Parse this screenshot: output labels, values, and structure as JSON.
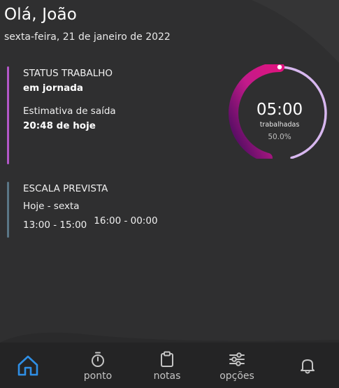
{
  "header": {
    "greeting": "Olá, João",
    "date": "sexta-feira, 21 de janeiro de 2022"
  },
  "status_card": {
    "title": "STATUS TRABALHO",
    "status": "em jornada",
    "exit_label": "Estimativa de saída",
    "exit_value": "20:48 de hoje",
    "accent": "#b357c8"
  },
  "schedule_card": {
    "title": "ESCALA PREVISTA",
    "days": "Hoje - sexta",
    "shift_1": "13:00 - 15:00",
    "shift_2": "16:00 - 00:00",
    "accent": "#5a7686"
  },
  "gauge": {
    "time": "05:00",
    "caption": "trabalhadas",
    "percent_label": "50.0%",
    "progress": 0.5,
    "track_color": "#d7b7ef",
    "fill_gradient": [
      "#3a0a5a",
      "#c21a8a",
      "#e0147f"
    ]
  },
  "nav": {
    "items": [
      {
        "id": "home",
        "label": "",
        "icon": "home-icon",
        "active": true
      },
      {
        "id": "ponto",
        "label": "ponto",
        "icon": "stopwatch-icon",
        "active": false
      },
      {
        "id": "notas",
        "label": "notas",
        "icon": "clipboard-icon",
        "active": false
      },
      {
        "id": "opcoes",
        "label": "opções",
        "icon": "sliders-icon",
        "active": false
      },
      {
        "id": "notificacoes",
        "label": "",
        "icon": "bell-icon",
        "active": false
      }
    ],
    "active_color": "#2f8fe6"
  }
}
